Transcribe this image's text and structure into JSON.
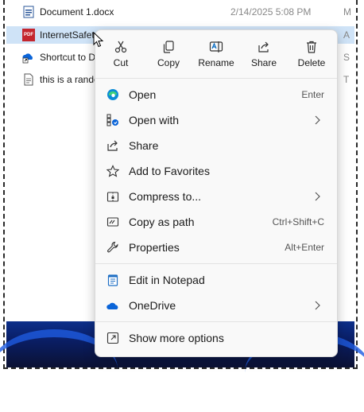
{
  "files": [
    {
      "name": "Document 1.docx",
      "date": "2/14/2025 5:08 PM",
      "extra": "M",
      "icon": "word-doc-icon"
    },
    {
      "name": "InternetSafet",
      "date": "",
      "extra": "A",
      "icon": "pdf-icon",
      "badge": "PDF"
    },
    {
      "name": "Shortcut to D",
      "date": "",
      "extra": "S",
      "icon": "onedrive-shortcut-icon"
    },
    {
      "name": "this is a rando",
      "date": "",
      "extra": "T",
      "icon": "text-file-icon"
    }
  ],
  "toolbar": {
    "cut": "Cut",
    "copy": "Copy",
    "rename": "Rename",
    "share": "Share",
    "delete": "Delete"
  },
  "menu_items": [
    {
      "label": "Open",
      "accel": "Enter",
      "icon": "edge-icon"
    },
    {
      "label": "Open with",
      "accel": "",
      "icon": "open-with-icon",
      "submenu": true
    },
    {
      "label": "Share",
      "accel": "",
      "icon": "share-icon"
    },
    {
      "label": "Add to Favorites",
      "accel": "",
      "icon": "star-icon"
    },
    {
      "label": "Compress to...",
      "accel": "",
      "icon": "zip-icon",
      "submenu": true
    },
    {
      "label": "Copy as path",
      "accel": "Ctrl+Shift+C",
      "icon": "copy-path-icon"
    },
    {
      "label": "Properties",
      "accel": "Alt+Enter",
      "icon": "wrench-icon"
    },
    {
      "label": "Edit in Notepad",
      "accel": "",
      "icon": "notepad-icon"
    },
    {
      "label": "OneDrive",
      "accel": "",
      "icon": "onedrive-icon",
      "submenu": true
    },
    {
      "label": "Show more options",
      "accel": "",
      "icon": "more-options-icon"
    }
  ],
  "colors": {
    "accent": "#0067c0",
    "selection": "#cfe3f7",
    "pdf_red": "#c4262e",
    "onedrive_blue": "#0a64d8"
  }
}
